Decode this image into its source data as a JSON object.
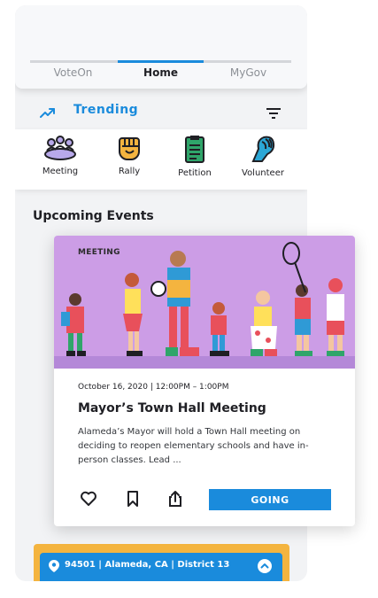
{
  "tabs": [
    {
      "label": "VoteOn"
    },
    {
      "label": "Home",
      "active": true
    },
    {
      "label": "MyGov"
    }
  ],
  "trending": {
    "label": "Trending",
    "icon": "trending-up-icon",
    "filter_icon": "filter-icon"
  },
  "categories": [
    {
      "label": "Meeting",
      "icon": "meeting-icon"
    },
    {
      "label": "Rally",
      "icon": "rally-fist-icon"
    },
    {
      "label": "Petition",
      "icon": "petition-clipboard-icon"
    },
    {
      "label": "Volunteer",
      "icon": "volunteer-hand-icon"
    }
  ],
  "events_section": {
    "title": "Upcoming Events"
  },
  "event_card": {
    "tag": "MEETING",
    "date": "October 16, 2020 | 12:00PM – 1:00PM",
    "title": "Mayor’s Town Hall Meeting",
    "description": "Alameda’s Mayor will hold a Town Hall meeting on deciding to reopen elementary schools and have in-person classes. Lead ...",
    "going_label": "GOING",
    "hero_color": "#cc9de6",
    "actions": [
      "heart-icon",
      "bookmark-icon",
      "share-icon"
    ]
  },
  "location": {
    "text": "94501 | Alameda, CA | District 13"
  },
  "colors": {
    "accent": "#1a8bdc",
    "location_border": "#f4b43f",
    "meeting": "#9f8de0",
    "rally": "#f4b43f",
    "petition": "#2fa56a",
    "volunteer": "#2ba7d6"
  }
}
